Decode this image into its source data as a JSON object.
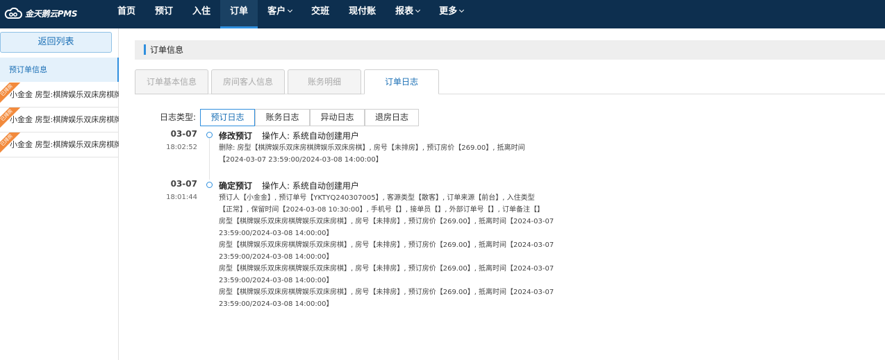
{
  "app": {
    "logo_text": "金天鹅云PMS"
  },
  "nav": {
    "items": [
      {
        "label": "首页",
        "dropdown": false,
        "active": false
      },
      {
        "label": "预订",
        "dropdown": false,
        "active": false
      },
      {
        "label": "入住",
        "dropdown": false,
        "active": false
      },
      {
        "label": "订单",
        "dropdown": false,
        "active": true
      },
      {
        "label": "客户",
        "dropdown": true,
        "active": false
      },
      {
        "label": "交班",
        "dropdown": false,
        "active": false
      },
      {
        "label": "现付账",
        "dropdown": false,
        "active": false
      },
      {
        "label": "报表",
        "dropdown": true,
        "active": false
      },
      {
        "label": "更多",
        "dropdown": true,
        "active": false
      }
    ]
  },
  "sidebar": {
    "back_label": "返回列表",
    "pre_order_label": "预订单信息",
    "guests": [
      {
        "ribbon": "已排房",
        "text": "小金金  房型:棋牌娱乐双床房棋牌娱乐双床房棋"
      },
      {
        "ribbon": "已排房",
        "text": "小金金  房型:棋牌娱乐双床房棋牌娱乐双床房棋"
      },
      {
        "ribbon": "已排房",
        "text": "小金金  房型:棋牌娱乐双床房棋牌娱乐双床房棋"
      }
    ]
  },
  "main": {
    "section_title": "订单信息",
    "tabs": [
      {
        "label": "订单基本信息",
        "active": false
      },
      {
        "label": "房间客人信息",
        "active": false
      },
      {
        "label": "账务明细",
        "active": false
      },
      {
        "label": "订单日志",
        "active": true
      }
    ],
    "log_type_label": "日志类型:",
    "log_types": [
      {
        "label": "预订日志",
        "active": true
      },
      {
        "label": "账务日志",
        "active": false
      },
      {
        "label": "异动日志",
        "active": false
      },
      {
        "label": "退房日志",
        "active": false
      }
    ],
    "entries": [
      {
        "date": "03-07",
        "time": "18:02:52",
        "action": "修改预订",
        "operator": "操作人:  系统自动创建用户",
        "lines": [
          "删除: 房型【棋牌娱乐双床房棋牌娱乐双床房棋】, 房号【未排房】, 预订房价【269.00】, 抵离时间",
          "【2024-03-07 23:59:00/2024-03-08 14:00:00】"
        ]
      },
      {
        "date": "03-07",
        "time": "18:01:44",
        "action": "确定预订",
        "operator": "操作人:  系统自动创建用户",
        "lines": [
          "预订人【小金金】, 预订单号【YKTYQ240307005】, 客源类型【散客】, 订单来源【前台】, 入住类型",
          "【正常】, 保留时间【2024-03-08 10:30:00】, 手机号【】, 接单员【】, 外部订单号【】, 订单备注【】",
          "房型【棋牌娱乐双床房棋牌娱乐双床房棋】, 房号【未排房】, 预订房价【269.00】, 抵离时间【2024-03-07",
          "23:59:00/2024-03-08 14:00:00】",
          "房型【棋牌娱乐双床房棋牌娱乐双床房棋】, 房号【未排房】, 预订房价【269.00】, 抵离时间【2024-03-07",
          "23:59:00/2024-03-08 14:00:00】",
          "房型【棋牌娱乐双床房棋牌娱乐双床房棋】, 房号【未排房】, 预订房价【269.00】, 抵离时间【2024-03-07",
          "23:59:00/2024-03-08 14:00:00】",
          "房型【棋牌娱乐双床房棋牌娱乐双床房棋】, 房号【未排房】, 预订房价【269.00】, 抵离时间【2024-03-07",
          "23:59:00/2024-03-08 14:00:00】"
        ]
      }
    ]
  },
  "colors": {
    "topbar": "#0d2f4f",
    "accent": "#2f8fde",
    "ribbon": "#f28a3c"
  }
}
